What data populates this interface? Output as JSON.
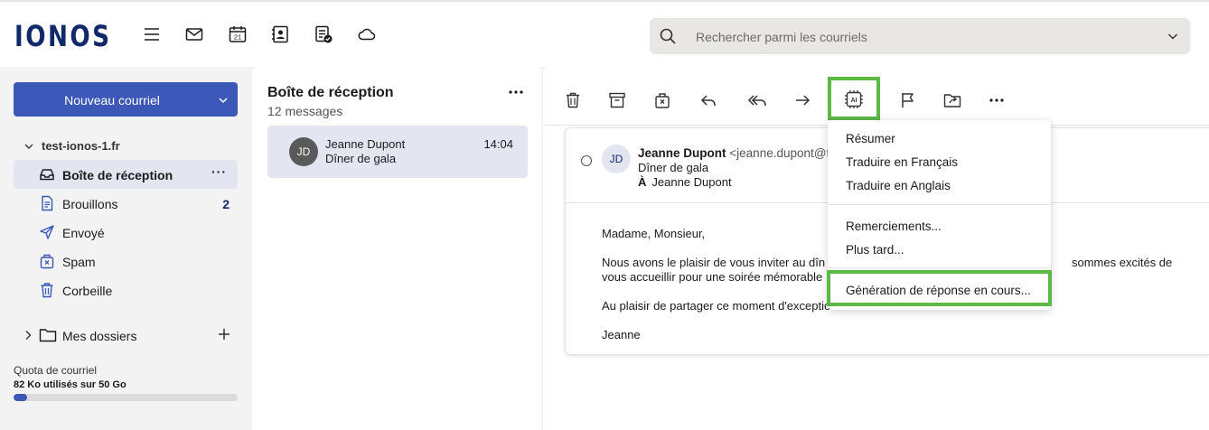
{
  "brand": {
    "logo": "IONOS",
    "accent": "#3b58b8",
    "highlight": "#5cb946"
  },
  "header": {
    "icons": [
      "menu-icon",
      "mail-icon",
      "calendar-icon",
      "contacts-icon",
      "tasks-icon",
      "cloud-icon"
    ],
    "calendar_day": "21",
    "search_placeholder": "Rechercher parmi les courriels"
  },
  "sidebar": {
    "new_mail_label": "Nouveau courriel",
    "account": "test-ionos-1.fr",
    "folders": [
      {
        "label": "Boîte de réception",
        "icon": "inbox-icon",
        "active": true,
        "more": "···"
      },
      {
        "label": "Brouillons",
        "icon": "draft-icon",
        "count": "2"
      },
      {
        "label": "Envoyé",
        "icon": "send-icon"
      },
      {
        "label": "Spam",
        "icon": "spam-icon"
      },
      {
        "label": "Corbeille",
        "icon": "trash-icon"
      }
    ],
    "my_folders": "Mes dossiers",
    "quota_label": "Quota de courriel",
    "quota_value": "82 Ko utilisés sur 50 Go",
    "quota_fill_percent": 6
  },
  "message_list": {
    "title": "Boîte de réception",
    "count": "12 messages",
    "items": [
      {
        "initials": "JD",
        "sender": "Jeanne Dupont",
        "subject": "Dîner de gala",
        "time": "14:04"
      }
    ]
  },
  "toolbar": {
    "icons": [
      "delete-icon",
      "archive-icon",
      "spam-icon",
      "reply-icon",
      "reply-all-icon",
      "forward-icon",
      "ai-icon",
      "flag-icon",
      "move-icon",
      "more-icon"
    ],
    "ai_label": "AI"
  },
  "email": {
    "initials": "JD",
    "sender_name": "Jeanne Dupont",
    "sender_email": "<jeanne.dupont@te",
    "subject": "Dîner de gala",
    "to_label": "À",
    "to_name": "Jeanne Dupont",
    "body": [
      "Madame, Monsieur,",
      "Nous avons le plaisir de vous inviter au dîn",
      "sommes excités de",
      "vous accueillir pour une soirée mémorable",
      "Au plaisir de partager ce moment d'exception avec vous.",
      "Jeanne"
    ]
  },
  "ai_menu": {
    "items": [
      "Résumer",
      "Traduire en Français",
      "Traduire en Anglais",
      "Remerciements...",
      "Plus tard...",
      "Génération de réponse en cours..."
    ]
  }
}
